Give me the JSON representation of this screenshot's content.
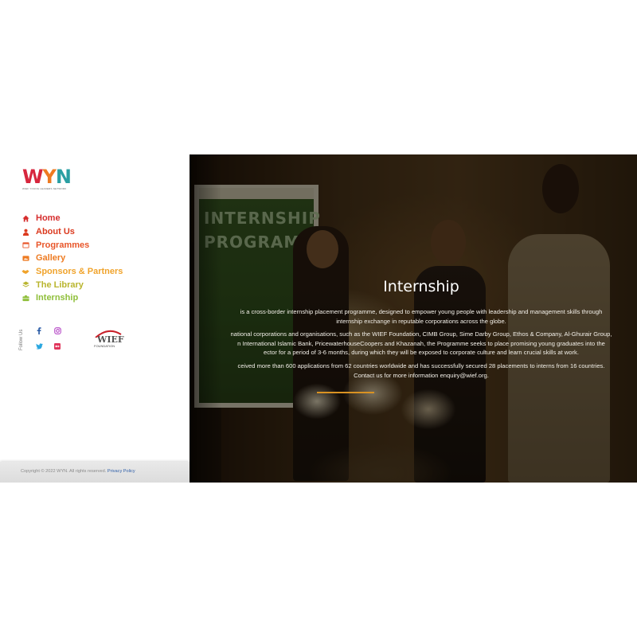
{
  "logo": {
    "letters": [
      "W",
      "Y",
      "N"
    ],
    "colors": [
      "#d7263d",
      "#ee7b22",
      "#2b9fa3"
    ],
    "subtitle": "WIEF YOUNG LEADERS NETWORK"
  },
  "menu": [
    {
      "label": "Home",
      "icon": "home-icon",
      "color": "#d62d2d"
    },
    {
      "label": "About Us",
      "icon": "user-icon",
      "color": "#db3a1f"
    },
    {
      "label": "Programmes",
      "icon": "calendar-icon",
      "color": "#e8562a"
    },
    {
      "label": "Gallery",
      "icon": "gallery-icon",
      "color": "#ee7b22"
    },
    {
      "label": "Sponsors & Partners",
      "icon": "handshake-icon",
      "color": "#f0a32b"
    },
    {
      "label": "The Library",
      "icon": "layers-icon",
      "color": "#b9b52e"
    },
    {
      "label": "Internship",
      "icon": "briefcase-icon",
      "color": "#8fbf3a"
    }
  ],
  "follow_label": "Follow Us",
  "social": {
    "facebook_color": "#2f5fa8",
    "instagram_color": "#b548c6",
    "twitter_color": "#2aa7e0",
    "flickr_color": "#e0345a"
  },
  "wief": {
    "word": "WIEF",
    "subtitle": "FOUNDATION",
    "arc_color": "#c8202a"
  },
  "hero": {
    "banner_line1": "INTERNSHIP",
    "banner_line2": "PROGRAMME",
    "title": "Internship",
    "para1_line1": "is a cross-border internship placement programme, designed to empower young people with leadership and management skills through",
    "para1_line2": "internship exchange in reputable corporations across the globe.",
    "para2_line1": "national corporations and organisations, such as the WIEF Foundation, CIMB Group, Sime Darby Group, Ethos & Company, Al-Ghurair Group,",
    "para2_line2": "n International Islamic Bank, PricewaterhouseCoopers and Khazanah, the Programme seeks to place promising young graduates into the",
    "para2_line3": "ector for a period of 3-6 months, during which they will be exposed to corporate culture and learn crucial skills at work.",
    "para3_line1": "ceived more than 600 applications from 62 countries worldwide and has successfully secured 28 placements to interns from 16 countries.",
    "para3_line2": "Contact us for more information enquiry@wief.org.",
    "accent": "#d99222"
  },
  "footer": {
    "copyright": "Copyright © 2022 WYN. All rights reserved.",
    "privacy": "Privacy Policy"
  }
}
